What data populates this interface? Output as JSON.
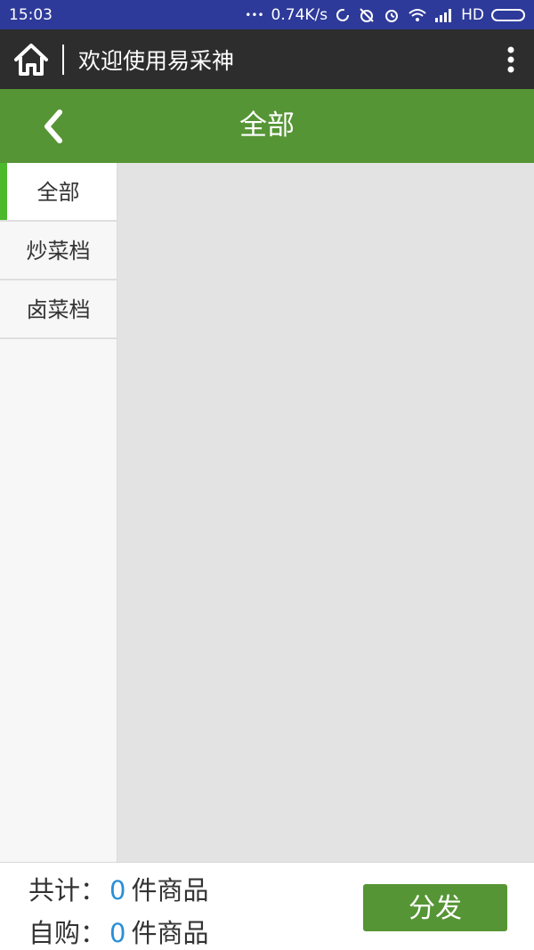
{
  "status_bar": {
    "time": "15:03",
    "network_speed": "0.74K/s",
    "network_type": "HD",
    "dots": "•••",
    "icons": [
      "sync-icon",
      "alarm-off-icon",
      "alarm-icon",
      "wifi-icon",
      "signal-icon",
      "battery-icon"
    ]
  },
  "app_bar": {
    "title": "欢迎使用易采神",
    "icons": [
      "home-icon",
      "more-vertical-icon"
    ]
  },
  "page_header": {
    "title": "全部",
    "back_icon": "chevron-left-icon",
    "color": "#569535"
  },
  "sidebar": {
    "items": [
      {
        "label": "全部",
        "active": true
      },
      {
        "label": "炒菜档",
        "active": false
      },
      {
        "label": "卤菜档",
        "active": false
      }
    ],
    "active_indicator_color": "#4cb82b"
  },
  "footer": {
    "total_label": "共计：",
    "total_count": "0",
    "total_unit": "件商品",
    "self_label": "自购：",
    "self_count": "0",
    "self_unit": "件商品",
    "dispatch_button": "分发",
    "count_color": "#2a8fd6"
  }
}
